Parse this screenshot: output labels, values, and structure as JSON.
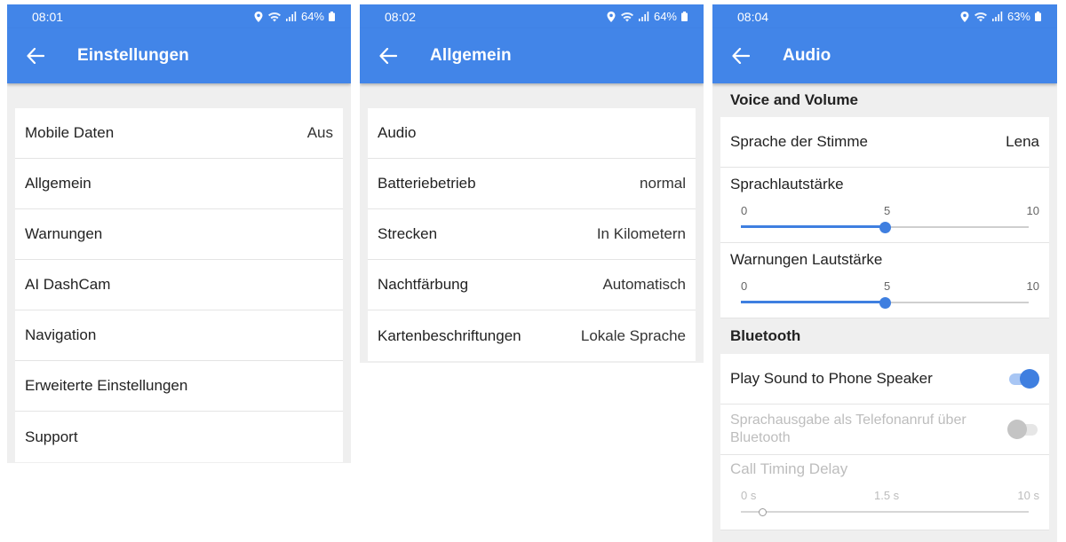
{
  "screens": [
    {
      "time": "08:01",
      "battery": "64%",
      "title": "Einstellungen",
      "rows": [
        {
          "label": "Mobile Daten",
          "value": "Aus"
        },
        {
          "label": "Allgemein",
          "value": ""
        },
        {
          "label": "Warnungen",
          "value": ""
        },
        {
          "label": "AI DashCam",
          "value": ""
        },
        {
          "label": "Navigation",
          "value": ""
        },
        {
          "label": "Erweiterte Einstellungen",
          "value": ""
        },
        {
          "label": "Support",
          "value": ""
        }
      ]
    },
    {
      "time": "08:02",
      "battery": "64%",
      "title": "Allgemein",
      "rows": [
        {
          "label": "Audio",
          "value": ""
        },
        {
          "label": "Batteriebetrieb",
          "value": "normal"
        },
        {
          "label": "Strecken",
          "value": "In Kilometern"
        },
        {
          "label": "Nachtfärbung",
          "value": "Automatisch"
        },
        {
          "label": "Kartenbeschriftungen",
          "value": "Lokale Sprache"
        }
      ]
    },
    {
      "time": "08:04",
      "battery": "63%",
      "title": "Audio",
      "voice_section": "Voice and Volume",
      "voice": {
        "label": "Sprache der Stimme",
        "value": "Lena"
      },
      "speech_volume": {
        "label": "Sprachlautstärke",
        "min": "0",
        "mid": "5",
        "max": "10",
        "value": 5
      },
      "warning_volume": {
        "label": "Warnungen Lautstärke",
        "min": "0",
        "mid": "5",
        "max": "10",
        "value": 5
      },
      "bt_section": "Bluetooth",
      "phone_speaker": {
        "label": "Play Sound to Phone Speaker",
        "on": true
      },
      "phone_call": {
        "label": "Sprachausgabe als Telefonanruf über Bluetooth",
        "on": false
      },
      "call_delay": {
        "label": "Call Timing Delay",
        "min": "0 s",
        "mid": "1.5 s",
        "max": "10 s",
        "value_seconds": 0.75
      }
    }
  ],
  "colors": {
    "accent": "#4285e8",
    "slider": "#3f7fe0",
    "background": "#efefef"
  },
  "icons": [
    "back-arrow-icon",
    "location-icon",
    "wifi-icon",
    "signal-icon",
    "battery-icon"
  ]
}
